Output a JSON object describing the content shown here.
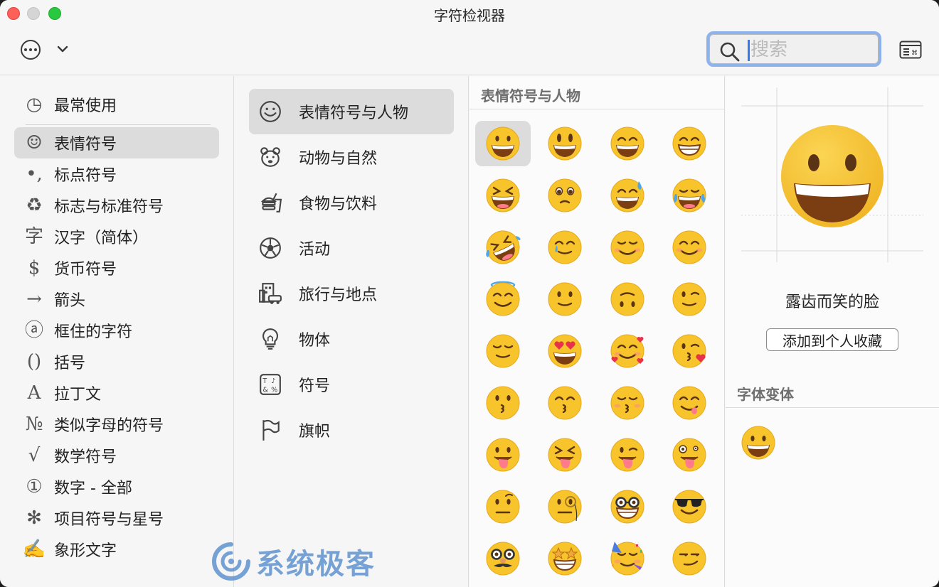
{
  "window": {
    "title": "字符检视器"
  },
  "toolbar": {
    "more_icon": "ellipsis-circle-icon",
    "chevron_icon": "chevron-down-icon",
    "search_placeholder": "搜索",
    "keyboard_icon": "keyboard-viewer-icon"
  },
  "categories": [
    {
      "label": "最常使用",
      "icon": "clock-icon",
      "glyph": "◷"
    },
    {
      "label": "表情符号",
      "icon": "smiley-icon",
      "glyph": "☺",
      "selected": true
    },
    {
      "label": "标点符号",
      "icon": "punctuation-icon",
      "glyph": "•,"
    },
    {
      "label": "标志与标准符号",
      "icon": "recycle-icon",
      "glyph": "♻"
    },
    {
      "label": "汉字（简体）",
      "icon": "han-icon",
      "glyph": "字"
    },
    {
      "label": "货币符号",
      "icon": "dollar-icon",
      "glyph": "$"
    },
    {
      "label": "箭头",
      "icon": "arrow-icon",
      "glyph": "→"
    },
    {
      "label": "框住的字符",
      "icon": "circled-a-icon",
      "glyph": "ⓐ"
    },
    {
      "label": "括号",
      "icon": "parentheses-icon",
      "glyph": "()"
    },
    {
      "label": "拉丁文",
      "icon": "latin-a-icon",
      "glyph": "A"
    },
    {
      "label": "类似字母的符号",
      "icon": "numero-icon",
      "glyph": "№"
    },
    {
      "label": "数学符号",
      "icon": "sqrt-icon",
      "glyph": "√"
    },
    {
      "label": "数字 - 全部",
      "icon": "circled-one-icon",
      "glyph": "①"
    },
    {
      "label": "项目符号与星号",
      "icon": "asterisk-icon",
      "glyph": "✻"
    },
    {
      "label": "象形文字",
      "icon": "pictograph-icon",
      "glyph": "✍"
    }
  ],
  "subcategories": [
    {
      "label": "表情符号与人物",
      "icon": "smiley-face-icon",
      "selected": true
    },
    {
      "label": "动物与自然",
      "icon": "bear-icon"
    },
    {
      "label": "食物与饮料",
      "icon": "burger-drink-icon"
    },
    {
      "label": "活动",
      "icon": "soccer-ball-icon"
    },
    {
      "label": "旅行与地点",
      "icon": "building-car-icon"
    },
    {
      "label": "物体",
      "icon": "lightbulb-icon"
    },
    {
      "label": "符号",
      "icon": "symbols-icon"
    },
    {
      "label": "旗帜",
      "icon": "flag-icon"
    }
  ],
  "grid": {
    "heading": "表情符号与人物",
    "emojis": [
      "grinning-face",
      "grinning-face-big-eyes",
      "grinning-face-smiling-eyes",
      "beaming-face",
      "squinting-laughing-face",
      "face-holding-back-tears",
      "grinning-face-sweat",
      "tears-of-joy-face",
      "rolling-laughing-face",
      "smiling-face-tear",
      "smiling-face-blush",
      "smiling-face-smiling-eyes",
      "smiling-face-halo",
      "slightly-smiling-face",
      "upside-down-face",
      "winking-face",
      "relieved-face",
      "heart-eyes-face",
      "smiling-face-hearts",
      "face-blowing-kiss",
      "kissing-face",
      "kissing-face-smiling-eyes",
      "kissing-face-closed-eyes",
      "face-savoring-food",
      "face-with-tongue",
      "squinting-face-tongue",
      "winking-face-tongue",
      "zany-face",
      "face-raised-eyebrow",
      "face-monocle",
      "nerd-face",
      "smiling-face-sunglasses",
      "disguised-face",
      "star-struck-face",
      "partying-face",
      "smirking-face"
    ]
  },
  "detail": {
    "name": "露齿而笑的脸",
    "add_favorite": "添加到个人收藏",
    "font_variants_heading": "字体变体"
  },
  "watermark": {
    "text": "系统极客",
    "icon": "watermark-logo-icon"
  },
  "colors": {
    "selection": "#dcdcdc",
    "search_focus": "#8db2ec",
    "emoji_yellow": "#f7c52b",
    "emoji_mouth": "#7b3d12",
    "watermark": "#5f93cf"
  }
}
